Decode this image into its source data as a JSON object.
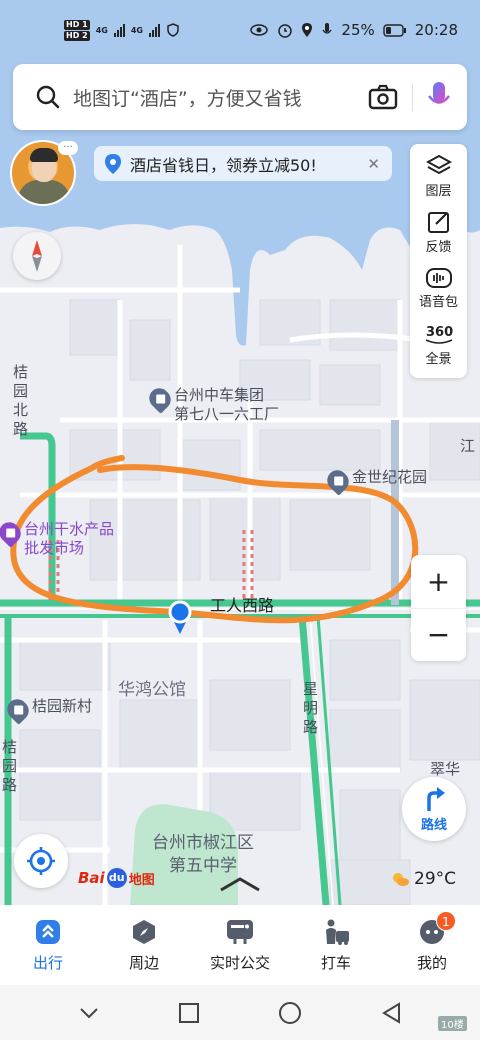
{
  "status_bar": {
    "sim1": "HD 1",
    "sim2": "HD 2",
    "net1": "4G",
    "net2": "4G",
    "battery": "25%",
    "time": "20:28"
  },
  "search": {
    "placeholder": "地图订“酒店”，方便又省钱",
    "icons": [
      "search-icon",
      "camera-icon",
      "microphone-icon"
    ]
  },
  "promo": {
    "text": "酒店省钱日，领券立减50!",
    "bubble": "..."
  },
  "tools": [
    {
      "label": "图层",
      "icon": "layers-icon"
    },
    {
      "label": "反馈",
      "icon": "feedback-icon"
    },
    {
      "label": "语音包",
      "icon": "voice-pack-icon"
    },
    {
      "label": "全景",
      "icon": "panorama-icon"
    }
  ],
  "panorama_degree": "360°",
  "zoom": {
    "in": "+",
    "out": "−"
  },
  "map": {
    "roads": {
      "jieyuan_north": "桔园北路",
      "gongren_west": "工人西路",
      "xingming": "星明路",
      "jieyuan": "桔园路",
      "jiang_partial": "江",
      "cuihua_partial": "翠华"
    },
    "pois": {
      "factory": "台州中车集团\n第七八一六工厂",
      "jinshiji": "金世纪花园",
      "market": "台州干水产品\n批发市场",
      "huahong": "华鸿公馆",
      "jieyuan_village": "桔园新村",
      "school": "台州市椒江区\n第五中学"
    },
    "colors": {
      "water": "#a9c9ee",
      "road_green": "#45c78f",
      "annotation": "#f28a2f",
      "location": "#1a73e8"
    }
  },
  "route_button": {
    "label": "路线"
  },
  "logo": {
    "bai": "Bai",
    "du": "du",
    "ditu": "地图"
  },
  "weather": {
    "temp": "29°C",
    "icon": "partly-cloudy-icon"
  },
  "nav": [
    {
      "label": "出行",
      "icon": "travel-icon",
      "active": true
    },
    {
      "label": "周边",
      "icon": "compass-nearby-icon",
      "active": false
    },
    {
      "label": "实时公交",
      "icon": "bus-icon",
      "active": false
    },
    {
      "label": "打车",
      "icon": "taxi-icon",
      "active": false
    },
    {
      "label": "我的",
      "icon": "profile-icon",
      "active": false,
      "badge": "1"
    }
  ],
  "watermark": "10楼"
}
